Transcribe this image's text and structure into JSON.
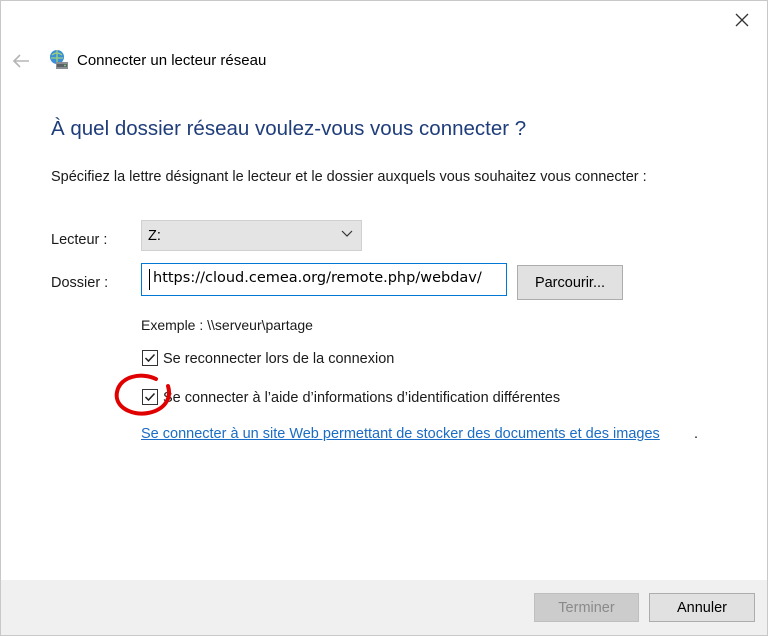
{
  "window": {
    "title": "Connecter un lecteur réseau",
    "close_icon": "close-icon",
    "back_icon": "back-arrow-icon",
    "app_icon": "network-drive-icon"
  },
  "heading": "À quel dossier réseau voulez-vous vous connecter ?",
  "instruction": "Spécifiez la lettre désignant le lecteur et le dossier auxquels vous souhaitez vous connecter :",
  "drive": {
    "label": "Lecteur :",
    "value": "Z:"
  },
  "folder": {
    "label": "Dossier :",
    "value": "https://cloud.cemea.org/remote.php/webdav/",
    "browse_label": "Parcourir..."
  },
  "example": "Exemple : \\\\serveur\\partage",
  "options": {
    "reconnect": {
      "label": "Se reconnecter lors de la connexion",
      "checked": true
    },
    "other_credentials": {
      "label": "Se connecter à l’aide d’informations d’identification différentes",
      "checked": true
    }
  },
  "web_link": {
    "text": "Se connecter à un site Web permettant de stocker des documents et des images",
    "suffix": "."
  },
  "buttons": {
    "finish": "Terminer",
    "finish_enabled": false,
    "cancel": "Annuler"
  },
  "colors": {
    "heading": "#1f3d7a",
    "link": "#1a6cc5",
    "focus_border": "#0078d7",
    "annotation": "#e00000"
  }
}
